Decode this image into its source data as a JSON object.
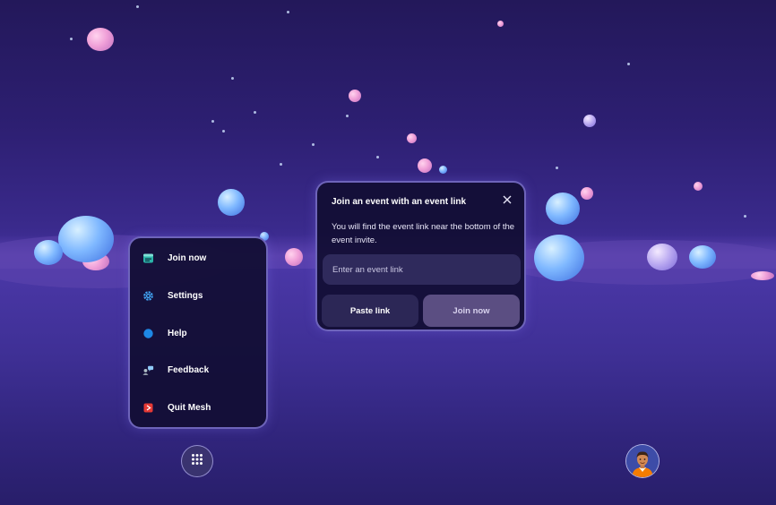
{
  "menu": {
    "items": [
      {
        "label": "Join now",
        "icon": "calendar-join-icon"
      },
      {
        "label": "Settings",
        "icon": "gear-icon"
      },
      {
        "label": "Help",
        "icon": "help-icon"
      },
      {
        "label": "Feedback",
        "icon": "feedback-icon"
      },
      {
        "label": "Quit Mesh",
        "icon": "quit-icon"
      }
    ]
  },
  "dialog": {
    "title": "Join an event with an event link",
    "body": "You will find the event link near the bottom of the event invite.",
    "input_placeholder": "Enter an event link",
    "input_value": "",
    "paste_label": "Paste link",
    "join_label": "Join now"
  },
  "dock": {
    "apps_icon": "grid-icon",
    "avatar_icon": "user-avatar"
  },
  "colors": {
    "accent_blue": "#1e88e5",
    "quit_red": "#e53935",
    "join_teal": "#2bb3a8"
  }
}
